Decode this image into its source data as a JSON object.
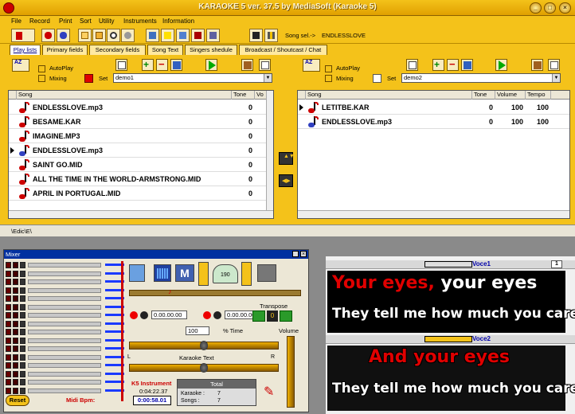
{
  "window": {
    "title": "KARAOKE 5   ver. 37.5 by MediaSoft (Karaoke 5)"
  },
  "menu": [
    "File",
    "Record",
    "Print",
    "Sort",
    "Utility",
    "Instruments",
    "Information"
  ],
  "toolbar": {
    "song_sel_label": "Song sel.->",
    "song_sel_value": "ENDLESSLOVE"
  },
  "tabs": [
    "Play lists",
    "Primary fields",
    "Secondary fields",
    "Song Text",
    "Singers shedule",
    "Broadcast / Shoutcast / Chat"
  ],
  "left_list": {
    "autoplay": "AutoPlay",
    "mixing": "Mixing",
    "set": "Set",
    "set_value": "demo1",
    "columns": [
      "Song",
      "Tone",
      "Vo"
    ],
    "rows": [
      {
        "song": "ENDLESSLOVE.mp3",
        "tone": "0",
        "icon": "red"
      },
      {
        "song": "BESAME.KAR",
        "tone": "0",
        "icon": "red"
      },
      {
        "song": "IMAGINE.MP3",
        "tone": "0",
        "icon": "red"
      },
      {
        "song": "ENDLESSLOVE.mp3",
        "tone": "0",
        "icon": "blue"
      },
      {
        "song": "SAINT GO.MID",
        "tone": "0",
        "icon": "red"
      },
      {
        "song": "ALL THE TIME IN THE WORLD-ARMSTRONG.MID",
        "tone": "0",
        "icon": "red"
      },
      {
        "song": "APRIL IN PORTUGAL.MID",
        "tone": "0",
        "icon": "red"
      }
    ]
  },
  "right_list": {
    "autoplay": "AutoPlay",
    "mixing": "Mixing",
    "set": "Set",
    "set_value": "demo2",
    "columns": [
      "Song",
      "Tone",
      "Volume",
      "Tempo"
    ],
    "rows": [
      {
        "song": "LETITBE.KAR",
        "tone": "0",
        "volume": "100",
        "tempo": "100",
        "icon": "red"
      },
      {
        "song": "ENDLESSLOVE.mp3",
        "tone": "0",
        "volume": "100",
        "tempo": "100",
        "icon": "blue"
      }
    ]
  },
  "path": "\\Edic\\E\\",
  "mixer": {
    "title": "Mixer",
    "time1": "0.00.00.00",
    "time2": "0.00.00.00",
    "transpose_label": "Transpose",
    "transpose_value": "0",
    "time_value": "100",
    "time_label": "% Time",
    "volume_label": "Volume",
    "karaoke_text_label": "Karaoke Text",
    "left_marker": "L",
    "right_marker": "R",
    "tempo_value": "190",
    "reset": "Reset",
    "midi_bpm": "Midi Bpm:",
    "instrument": "K5 Instrument",
    "elapsed": "0:04:22.37",
    "position": "0:00:58.01",
    "total_label": "Total",
    "karaoke_label": "Karaoke :",
    "karaoke_count": "7",
    "songs_label": "Songs :",
    "songs_count": "7"
  },
  "lyrics": {
    "voice1": "Voce1",
    "voice2": "Voce2",
    "counter": "1",
    "line1_sung": "Your eyes,",
    "line1_rest": " your eyes",
    "line2": "They tell me how much you care",
    "line3_sung": "And your eyes",
    "line4": "They tell me how much you care"
  },
  "colors": {
    "chrome": "#f4c21a",
    "sung_text": "#e00000",
    "lyric_text": "#ffffff",
    "set_red": "#e00000"
  }
}
